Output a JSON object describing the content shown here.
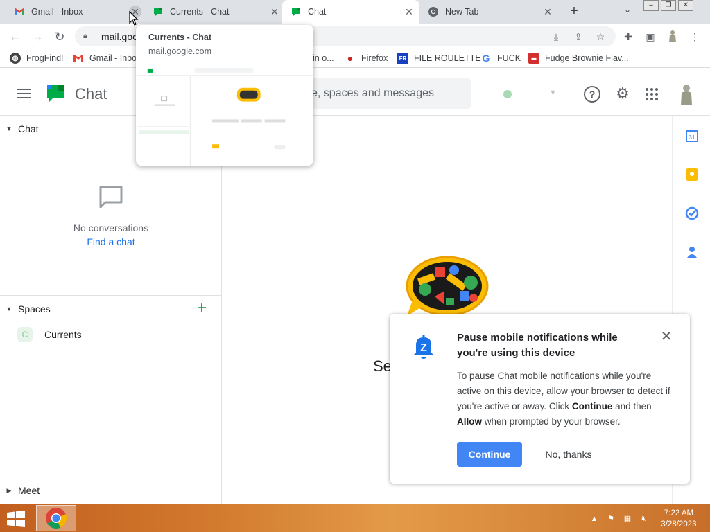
{
  "browser": {
    "tabs": [
      {
        "title": "Gmail - Inbox",
        "favicon": "gmail-icon"
      },
      {
        "title": "Currents - Chat",
        "favicon": "google-chat-icon"
      },
      {
        "title": "Chat",
        "favicon": "google-chat-icon"
      },
      {
        "title": "New Tab",
        "favicon": "chrome-icon"
      }
    ],
    "active_tab_index": 2,
    "omnibox_text": "mail.goog",
    "bookmarks": [
      {
        "label": "FrogFind!",
        "icon": "globe-icon"
      },
      {
        "label": "Gmail - Inbo",
        "icon": "gmail-icon"
      },
      {
        "label": "in o...",
        "icon": "bookmark-icon"
      },
      {
        "label": "Firefox",
        "icon": "firefox-icon"
      },
      {
        "label": "FILE ROULETTE",
        "icon": "file-roulette-icon"
      },
      {
        "label": "FUCK",
        "icon": "google-icon"
      },
      {
        "label": "Fudge Brownie Flav...",
        "icon": "recipe-icon"
      }
    ],
    "tab_preview": {
      "title": "Currents - Chat",
      "url": "mail.google.com"
    }
  },
  "app": {
    "title": "Chat",
    "search_placeholder": "e, spaces and messages",
    "status_color": "#a8dab5"
  },
  "sidebar": {
    "chat_section": "Chat",
    "empty_text": "No conversations",
    "find_chat": "Find a chat",
    "spaces_section": "Spaces",
    "spaces": [
      {
        "initial": "C",
        "name": "Currents"
      }
    ],
    "meet_section": "Meet"
  },
  "main": {
    "partial_text": "Se"
  },
  "dialog": {
    "title": "Pause mobile notifications while you're using this device",
    "body_1": "To pause Chat mobile notifications while you're active on this device, allow your browser to detect if you're active or away. Click ",
    "body_bold_1": "Continue",
    "body_2": " and then ",
    "body_bold_2": "Allow",
    "body_3": " when prompted by your browser.",
    "continue_label": "Continue",
    "no_thanks_label": "No, thanks"
  },
  "taskbar": {
    "time": "7:22 AM",
    "date": "3/28/2023"
  },
  "colors": {
    "accent_blue": "#4285f4",
    "chat_green": "#1e8e3e"
  }
}
